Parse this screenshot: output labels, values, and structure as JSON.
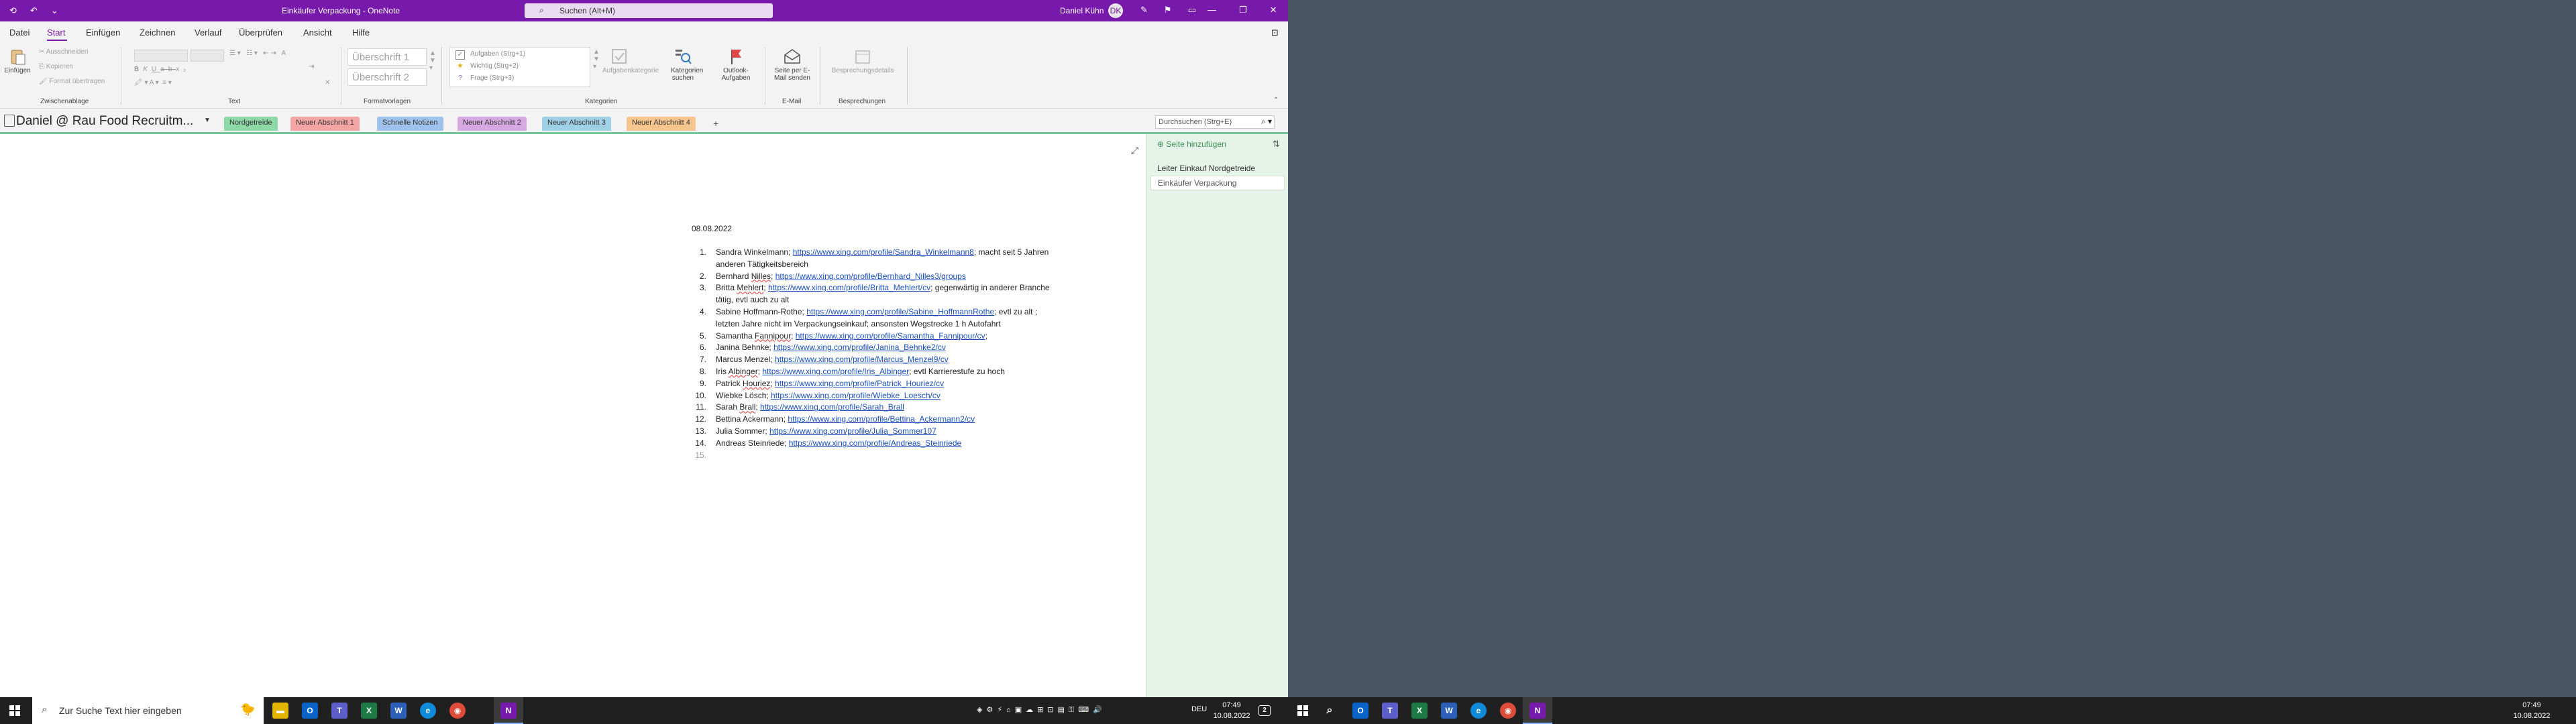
{
  "window": {
    "title": "Einkäufer Verpackung - OneNote",
    "search_placeholder": "Suchen (Alt+M)",
    "user_name": "Daniel Kühn",
    "user_initial": "DK"
  },
  "menu": {
    "items": [
      "Datei",
      "Start",
      "Einfügen",
      "Zeichnen",
      "Verlauf",
      "Überprüfen",
      "Ansicht",
      "Hilfe"
    ],
    "active": "Start"
  },
  "ribbon": {
    "clipboard": {
      "paste": "Einfügen",
      "cut": "Ausschneiden",
      "copy": "Kopieren",
      "format_painter": "Format übertragen",
      "label": "Zwischenablage"
    },
    "text_label": "Text",
    "styles": {
      "heading1": "Überschrift 1",
      "heading2": "Überschrift 2",
      "label": "Formatvorlagen"
    },
    "tags": {
      "items": [
        "Aufgaben (Strg+1)",
        "Wichtig (Strg+2)",
        "Frage (Strg+3)"
      ],
      "task_tag": "Aufgabenkategorie",
      "find_tags": "Kategorien suchen",
      "outlook_tasks": "Outlook-Aufgaben",
      "label": "Kategorien"
    },
    "email": {
      "send": "Seite per E-Mail senden",
      "label": "E-Mail"
    },
    "meetings": {
      "details": "Besprechungsdetails",
      "label": "Besprechungen"
    }
  },
  "notebook": {
    "name": "Daniel @ Rau Food Recruitm...",
    "sections": [
      {
        "label": "Nordgetreide",
        "color": "#8fd8a8",
        "active": true
      },
      {
        "label": "Neuer Abschnitt 1",
        "color": "#f4a6a6"
      },
      {
        "label": "Schnelle Notizen",
        "color": "#9fc3ec"
      },
      {
        "label": "Neuer Abschnitt 2",
        "color": "#d6a9e2"
      },
      {
        "label": "Neuer Abschnitt 3",
        "color": "#9fd0e6"
      },
      {
        "label": "Neuer Abschnitt 4",
        "color": "#f7c68f"
      }
    ],
    "search_placeholder": "Durchsuchen (Strg+E)"
  },
  "page": {
    "date": "08.08.2022",
    "entries": [
      {
        "num": "1.",
        "pre": "Sandra Winkelmann; ",
        "link": "https://www.xing.com/profile/Sandra_Winkelmann8",
        "post": "; macht seit 5 Jahren",
        "line2": "anderen Tätigkeitsbereich"
      },
      {
        "num": "2.",
        "pre": "Bernhard ",
        "sp": "Nilles",
        "pre2": ";  ",
        "link": "https://www.xing.com/profile/Bernhard_Nilles3/groups",
        "post": ""
      },
      {
        "num": "3.",
        "pre": "Britta ",
        "sp": "Mehlert",
        "pre2": "; ",
        "link": "https://www.xing.com/profile/Britta_Mehlert/cv",
        "post": "; gegenwärtig in anderer Branche",
        "line2": "tätig, evtl auch zu alt"
      },
      {
        "num": "4.",
        "pre": "Sabine Hoffmann-Rothe; ",
        "link": "https://www.xing.com/profile/Sabine_HoffmannRothe",
        "post": "; evtl zu alt ;",
        "line2": "letzten Jahre nicht im Verpackungseinkauf; ansonsten Wegstrecke 1 h Autofahrt"
      },
      {
        "num": "5.",
        "pre": "Samantha ",
        "sp": "Fannipour",
        "pre2": "; ",
        "link": "https://www.xing.com/profile/Samantha_Fannipour/cv",
        "post": ";"
      },
      {
        "num": "6.",
        "pre": "Janina Behnke; ",
        "link": "https://www.xing.com/profile/Janina_Behnke2/cv",
        "post": ""
      },
      {
        "num": "7.",
        "pre": "Marcus Menzel; ",
        "link": "https://www.xing.com/profile/Marcus_Menzel9/cv",
        "post": ""
      },
      {
        "num": "8.",
        "pre": "Iris ",
        "sp": "Albinger",
        "pre2": "; ",
        "link": "https://www.xing.com/profile/Iris_Albinger",
        "post": "; evtl Karrierestufe zu hoch"
      },
      {
        "num": "9.",
        "pre": "Patrick ",
        "sp": "Houriez",
        "pre2": "; ",
        "link": "https://www.xing.com/profile/Patrick_Houriez/cv",
        "post": ""
      },
      {
        "num": "10.",
        "pre": "Wiebke Lösch; ",
        "link": "https://www.xing.com/profile/Wiebke_Loesch/cv",
        "post": ""
      },
      {
        "num": "11.",
        "pre": "Sarah ",
        "sp": "Brall",
        "pre2": "; ",
        "link": "https://www.xing.com/profile/Sarah_Brall",
        "post": ""
      },
      {
        "num": "12.",
        "pre": "Bettina Ackermann; ",
        "link": "https://www.xing.com/profile/Bettina_Ackermann2/cv",
        "post": ""
      },
      {
        "num": "13.",
        "pre": "Julia Sommer; ",
        "link": "https://www.xing.com/profile/Julia_Sommer107",
        "post": ""
      },
      {
        "num": "14.",
        "pre": "Andreas Steinriede; ",
        "link": "https://www.xing.com/profile/Andreas_Steinriede",
        "post": ""
      },
      {
        "num": "15.",
        "pre": "",
        "link": "",
        "post": "",
        "empty": true
      }
    ]
  },
  "pages_panel": {
    "add_page": "Seite hinzufügen",
    "pages": [
      "Leiter Einkauf Nordgetreide",
      "Einkäufer Verpackung"
    ],
    "selected": "Einkäufer Verpackung"
  },
  "taskbar": {
    "search_placeholder": "Zur Suche Text hier eingeben",
    "lang": "DEU",
    "time": "07:49",
    "date": "10.08.2022"
  },
  "taskbar2": {
    "time": "07:49",
    "date": "10.08.2022"
  },
  "colors": {
    "accent": "#7719aa",
    "page_panel": "#e5f3e8",
    "link": "#1a4fbf",
    "desktop": "#4a5563"
  }
}
